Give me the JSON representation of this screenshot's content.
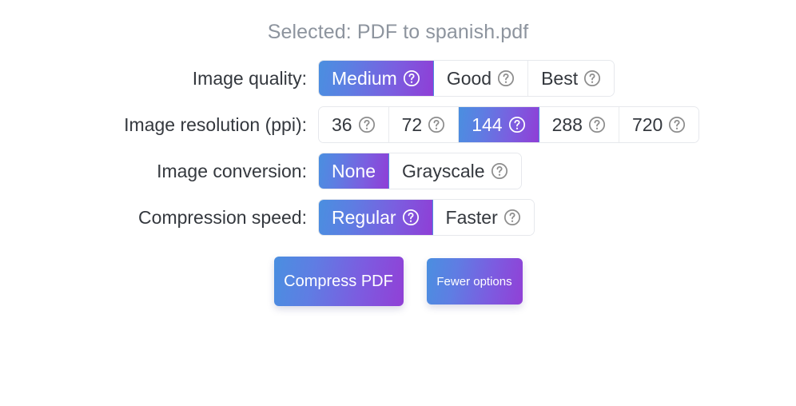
{
  "header": {
    "selected_file_text": "Selected: PDF to spanish.pdf",
    "muted_color": "#8d949e"
  },
  "theme": {
    "gradient_start": "#4a8fe0",
    "gradient_end": "#8f3ed6",
    "label_color": "#34383e",
    "border_color": "#e6e8ec",
    "help_icon_unselected_color": "#8d8d8d",
    "help_icon_selected_color": "#ffffff",
    "background": "#ffffff"
  },
  "help_icon_name": "help-circle-icon",
  "options": [
    {
      "key": "image-quality",
      "label": "Image quality:",
      "segments": [
        {
          "label": "Medium",
          "selected": true,
          "has_help": true
        },
        {
          "label": "Good",
          "selected": false,
          "has_help": true
        },
        {
          "label": "Best",
          "selected": false,
          "has_help": true
        }
      ]
    },
    {
      "key": "image-resolution",
      "label": "Image resolution (ppi):",
      "segments": [
        {
          "label": "36",
          "selected": false,
          "has_help": true
        },
        {
          "label": "72",
          "selected": false,
          "has_help": true
        },
        {
          "label": "144",
          "selected": true,
          "has_help": true
        },
        {
          "label": "288",
          "selected": false,
          "has_help": true
        },
        {
          "label": "720",
          "selected": false,
          "has_help": true
        }
      ]
    },
    {
      "key": "image-conversion",
      "label": "Image conversion:",
      "segments": [
        {
          "label": "None",
          "selected": true,
          "has_help": false
        },
        {
          "label": "Grayscale",
          "selected": false,
          "has_help": true
        }
      ]
    },
    {
      "key": "compression-speed",
      "label": "Compression speed:",
      "segments": [
        {
          "label": "Regular",
          "selected": true,
          "has_help": true
        },
        {
          "label": "Faster",
          "selected": false,
          "has_help": true
        }
      ]
    }
  ],
  "actions": {
    "primary_label": "Compress PDF",
    "secondary_label": "Fewer options"
  }
}
